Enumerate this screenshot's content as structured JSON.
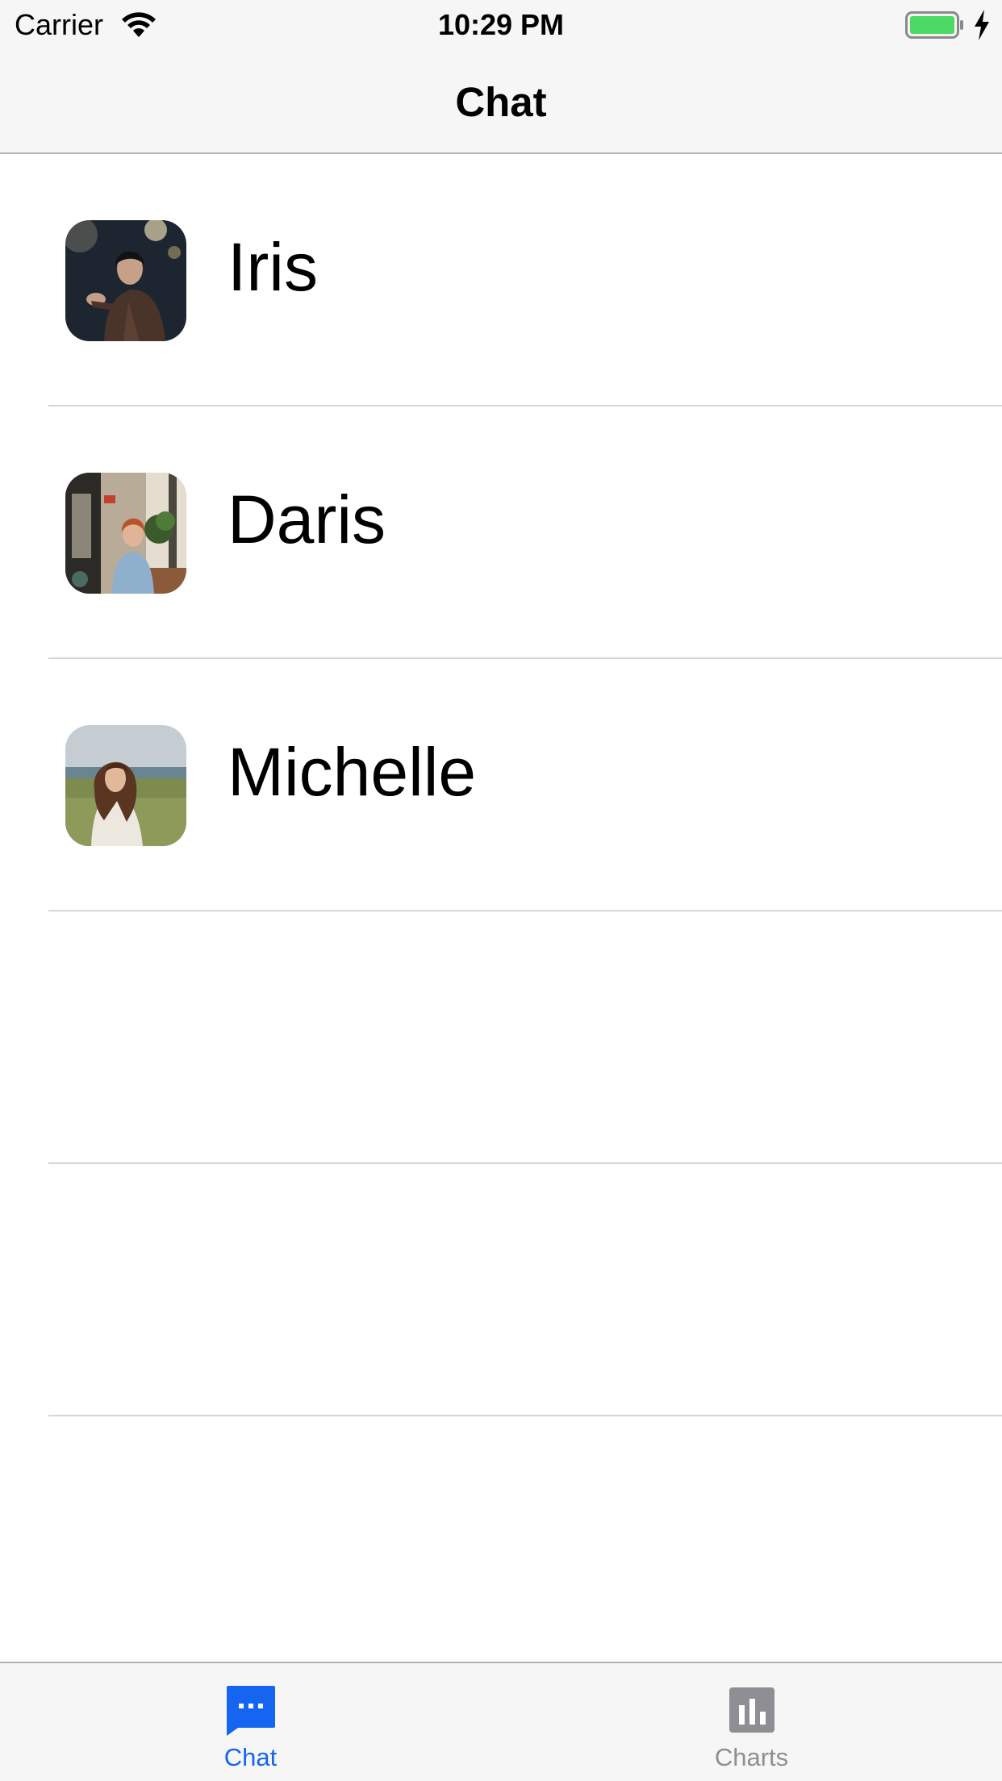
{
  "status_bar": {
    "carrier": "Carrier",
    "time": "10:29 PM",
    "battery_color": "#4cd964"
  },
  "nav": {
    "title": "Chat"
  },
  "chats": [
    {
      "name": "Iris",
      "avatar": "portrait-photo-dark"
    },
    {
      "name": "Daris",
      "avatar": "portrait-photo-cafe"
    },
    {
      "name": "Michelle",
      "avatar": "portrait-photo-field"
    }
  ],
  "tab_bar": {
    "active_color": "#1565f0",
    "inactive_color": "#8e8e93",
    "tabs": [
      {
        "label": "Chat",
        "icon": "chat-bubble-icon",
        "active": true
      },
      {
        "label": "Charts",
        "icon": "bar-chart-icon",
        "active": false
      }
    ]
  }
}
